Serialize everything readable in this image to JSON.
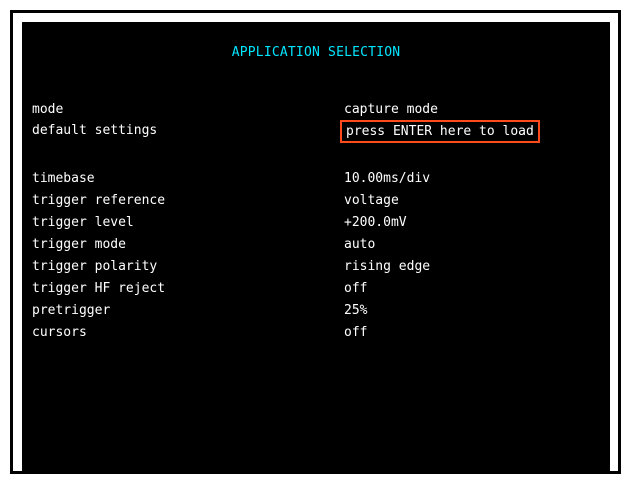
{
  "screen": {
    "title": "APPLICATION SELECTION",
    "settings": [
      {
        "label": "mode",
        "value": "capture mode"
      },
      {
        "label": "default settings",
        "value": "press ENTER here to load",
        "selected": true
      },
      {
        "label": "timebase",
        "value": "10.00ms/div"
      },
      {
        "label": "trigger reference",
        "value": "voltage"
      },
      {
        "label": "trigger level",
        "value": "+200.0mV"
      },
      {
        "label": "trigger mode",
        "value": "auto"
      },
      {
        "label": "trigger polarity",
        "value": "rising edge"
      },
      {
        "label": "trigger HF reject",
        "value": "off"
      },
      {
        "label": "pretrigger",
        "value": "25%"
      },
      {
        "label": "cursors",
        "value": "off"
      }
    ]
  },
  "colors": {
    "background": "#000000",
    "title": "#00e5ff",
    "text": "#ffffff",
    "selection_border": "#ff4a1c"
  }
}
